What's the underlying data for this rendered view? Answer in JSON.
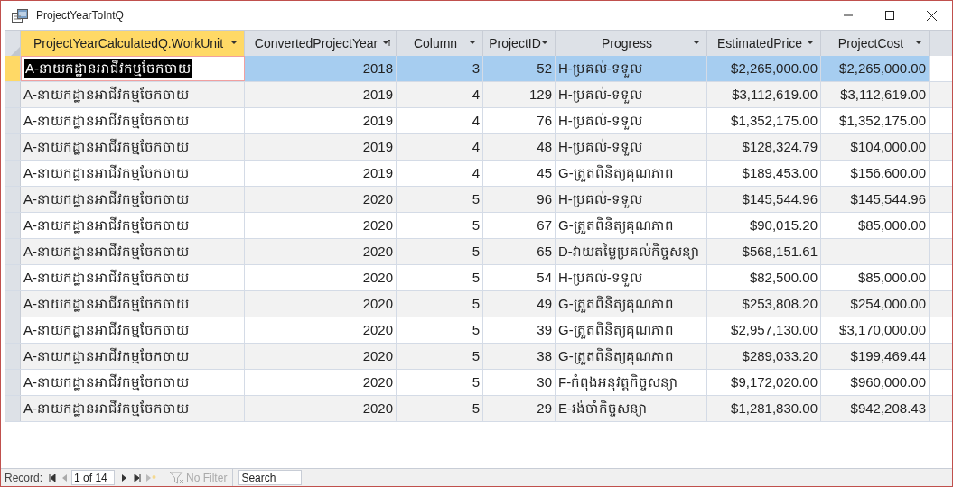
{
  "window": {
    "title": "ProjectYearToIntQ"
  },
  "table": {
    "columns": [
      {
        "label": "ProjectYearCalculatedQ.WorkUnit",
        "selected": true,
        "sorted": false
      },
      {
        "label": "ConvertedProjectYear",
        "selected": false,
        "sorted": true
      },
      {
        "label": "Column",
        "selected": false,
        "sorted": false
      },
      {
        "label": "ProjectID",
        "selected": false,
        "sorted": false
      },
      {
        "label": "Progress",
        "selected": false,
        "sorted": false
      },
      {
        "label": "EstimatedPrice",
        "selected": false,
        "sorted": false
      },
      {
        "label": "ProjectCost",
        "selected": false,
        "sorted": false
      }
    ],
    "rows": [
      {
        "selected": true,
        "cells": [
          "A-នាយកដ្ឋានអាជីវកម្មចែកចាយ",
          "2018",
          "3",
          "52",
          "H-ប្រគល់-ទទួល",
          "$2,265,000.00",
          "$2,265,000.00"
        ]
      },
      {
        "selected": false,
        "cells": [
          "A-នាយកដ្ឋានអាជីវកម្មចែកចាយ",
          "2019",
          "4",
          "129",
          "H-ប្រគល់-ទទួល",
          "$3,112,619.00",
          "$3,112,619.00"
        ]
      },
      {
        "selected": false,
        "cells": [
          "A-នាយកដ្ឋានអាជីវកម្មចែកចាយ",
          "2019",
          "4",
          "76",
          "H-ប្រគល់-ទទួល",
          "$1,352,175.00",
          "$1,352,175.00"
        ]
      },
      {
        "selected": false,
        "cells": [
          "A-នាយកដ្ឋានអាជីវកម្មចែកចាយ",
          "2019",
          "4",
          "48",
          "H-ប្រគល់-ទទួល",
          "$128,324.79",
          "$104,000.00"
        ]
      },
      {
        "selected": false,
        "cells": [
          "A-នាយកដ្ឋានអាជីវកម្មចែកចាយ",
          "2019",
          "4",
          "45",
          "G-ត្រួតពិនិត្យគុណភាព",
          "$189,453.00",
          "$156,600.00"
        ]
      },
      {
        "selected": false,
        "cells": [
          "A-នាយកដ្ឋានអាជីវកម្មចែកចាយ",
          "2020",
          "5",
          "96",
          "H-ប្រគល់-ទទួល",
          "$145,544.96",
          "$145,544.96"
        ]
      },
      {
        "selected": false,
        "cells": [
          "A-នាយកដ្ឋានអាជីវកម្មចែកចាយ",
          "2020",
          "5",
          "67",
          "G-ត្រួតពិនិត្យគុណភាព",
          "$90,015.20",
          "$85,000.00"
        ]
      },
      {
        "selected": false,
        "cells": [
          "A-នាយកដ្ឋានអាជីវកម្មចែកចាយ",
          "2020",
          "5",
          "65",
          "D-វាយតម្លៃប្រគល់កិច្ចសន្យា",
          "$568,151.61",
          ""
        ]
      },
      {
        "selected": false,
        "cells": [
          "A-នាយកដ្ឋានអាជីវកម្មចែកចាយ",
          "2020",
          "5",
          "54",
          "H-ប្រគល់-ទទួល",
          "$82,500.00",
          "$85,000.00"
        ]
      },
      {
        "selected": false,
        "cells": [
          "A-នាយកដ្ឋានអាជីវកម្មចែកចាយ",
          "2020",
          "5",
          "49",
          "G-ត្រួតពិនិត្យគុណភាព",
          "$253,808.20",
          "$254,000.00"
        ]
      },
      {
        "selected": false,
        "cells": [
          "A-នាយកដ្ឋានអាជីវកម្មចែកចាយ",
          "2020",
          "5",
          "39",
          "G-ត្រួតពិនិត្យគុណភាព",
          "$2,957,130.00",
          "$3,170,000.00"
        ]
      },
      {
        "selected": false,
        "cells": [
          "A-នាយកដ្ឋានអាជីវកម្មចែកចាយ",
          "2020",
          "5",
          "38",
          "G-ត្រួតពិនិត្យគុណភាព",
          "$289,033.20",
          "$199,469.44"
        ]
      },
      {
        "selected": false,
        "cells": [
          "A-នាយកដ្ឋានអាជីវកម្មចែកចាយ",
          "2020",
          "5",
          "30",
          "F-កំពុងអនុវត្តកិច្ចសន្យា",
          "$9,172,020.00",
          "$960,000.00"
        ]
      },
      {
        "selected": false,
        "cells": [
          "A-នាយកដ្ឋានអាជីវកម្មចែកចាយ",
          "2020",
          "5",
          "29",
          "E-រង់ចាំកិច្ចសន្យា",
          "$1,281,830.00",
          "$942,208.43"
        ]
      }
    ]
  },
  "status_bar": {
    "record_label": "Record:",
    "record_position": "1 of 14",
    "filter": {
      "label": "No Filter",
      "disabled": true
    },
    "search": {
      "placeholder": "Search"
    }
  }
}
